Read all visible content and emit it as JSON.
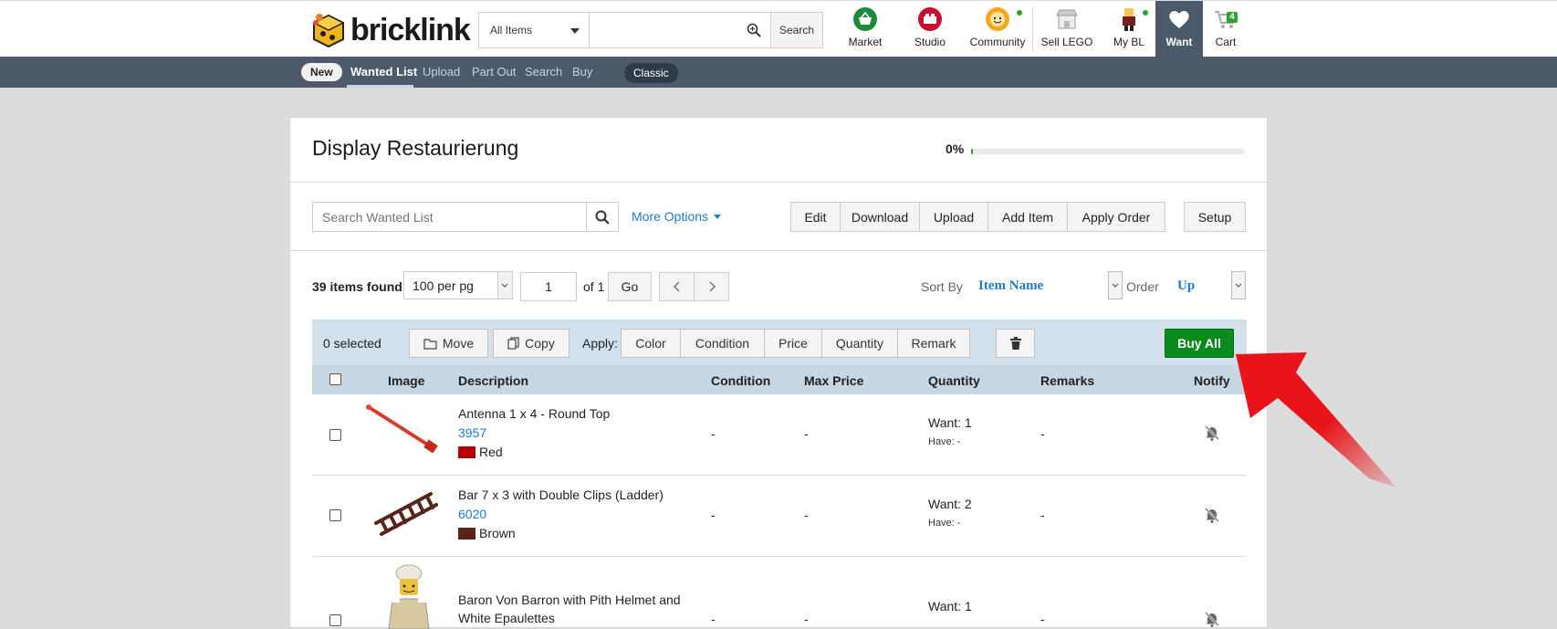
{
  "header": {
    "logo_text": "bricklink",
    "search": {
      "category": "All Items",
      "query": "",
      "button_label": "Search"
    },
    "nav": [
      {
        "label": "Market"
      },
      {
        "label": "Studio"
      },
      {
        "label": "Community"
      },
      {
        "label": "Sell LEGO"
      },
      {
        "label": "My BL"
      },
      {
        "label": "Want"
      },
      {
        "label": "Cart",
        "badge": "4"
      }
    ]
  },
  "subnav": {
    "new_label": "New",
    "links": [
      "Wanted List",
      "Upload",
      "Part Out",
      "Search",
      "Buy"
    ],
    "classic_label": "Classic"
  },
  "list": {
    "title": "Display Restaurierung",
    "progress_label": "0%",
    "progress_fraction": 0.0,
    "search_placeholder": "Search Wanted List",
    "more_options": "More Options",
    "actions": [
      "Edit",
      "Download",
      "Upload",
      "Add Item",
      "Apply Order"
    ],
    "setup_label": "Setup"
  },
  "pagination": {
    "count_label": "39 items found",
    "per_page": "100 per pg",
    "page": "1",
    "of_label": "of 1",
    "go_label": "Go",
    "sort_label": "Sort By",
    "sort_value": "Item Name",
    "order_label": "Order",
    "order_value": "Up"
  },
  "toolbar": {
    "selected_label": "0 selected",
    "move_label": "Move",
    "copy_label": "Copy",
    "apply_label": "Apply:",
    "apply_options": [
      "Color",
      "Condition",
      "Price",
      "Quantity",
      "Remark"
    ],
    "buy_all_label": "Buy All"
  },
  "table": {
    "columns": [
      "Image",
      "Description",
      "Condition",
      "Max Price",
      "Quantity",
      "Remarks",
      "Notify"
    ],
    "rows": [
      {
        "name": "Antenna 1 x 4 - Round Top",
        "part": "3957",
        "color_name": "Red",
        "color_hex": "#b40000",
        "condition": "-",
        "max_price": "-",
        "want": "Want: 1",
        "have": "Have: -",
        "remarks": "-"
      },
      {
        "name": "Bar 7 x 3 with Double Clips (Ladder)",
        "part": "6020",
        "color_name": "Brown",
        "color_hex": "#5a2418",
        "condition": "-",
        "max_price": "-",
        "want": "Want: 2",
        "have": "Have: -",
        "remarks": "-"
      },
      {
        "name": "Baron Von Barron with Pith Helmet and White Epaulettes",
        "condition": "-",
        "max_price": "-",
        "want": "Want: 1",
        "remarks": "-"
      }
    ]
  }
}
